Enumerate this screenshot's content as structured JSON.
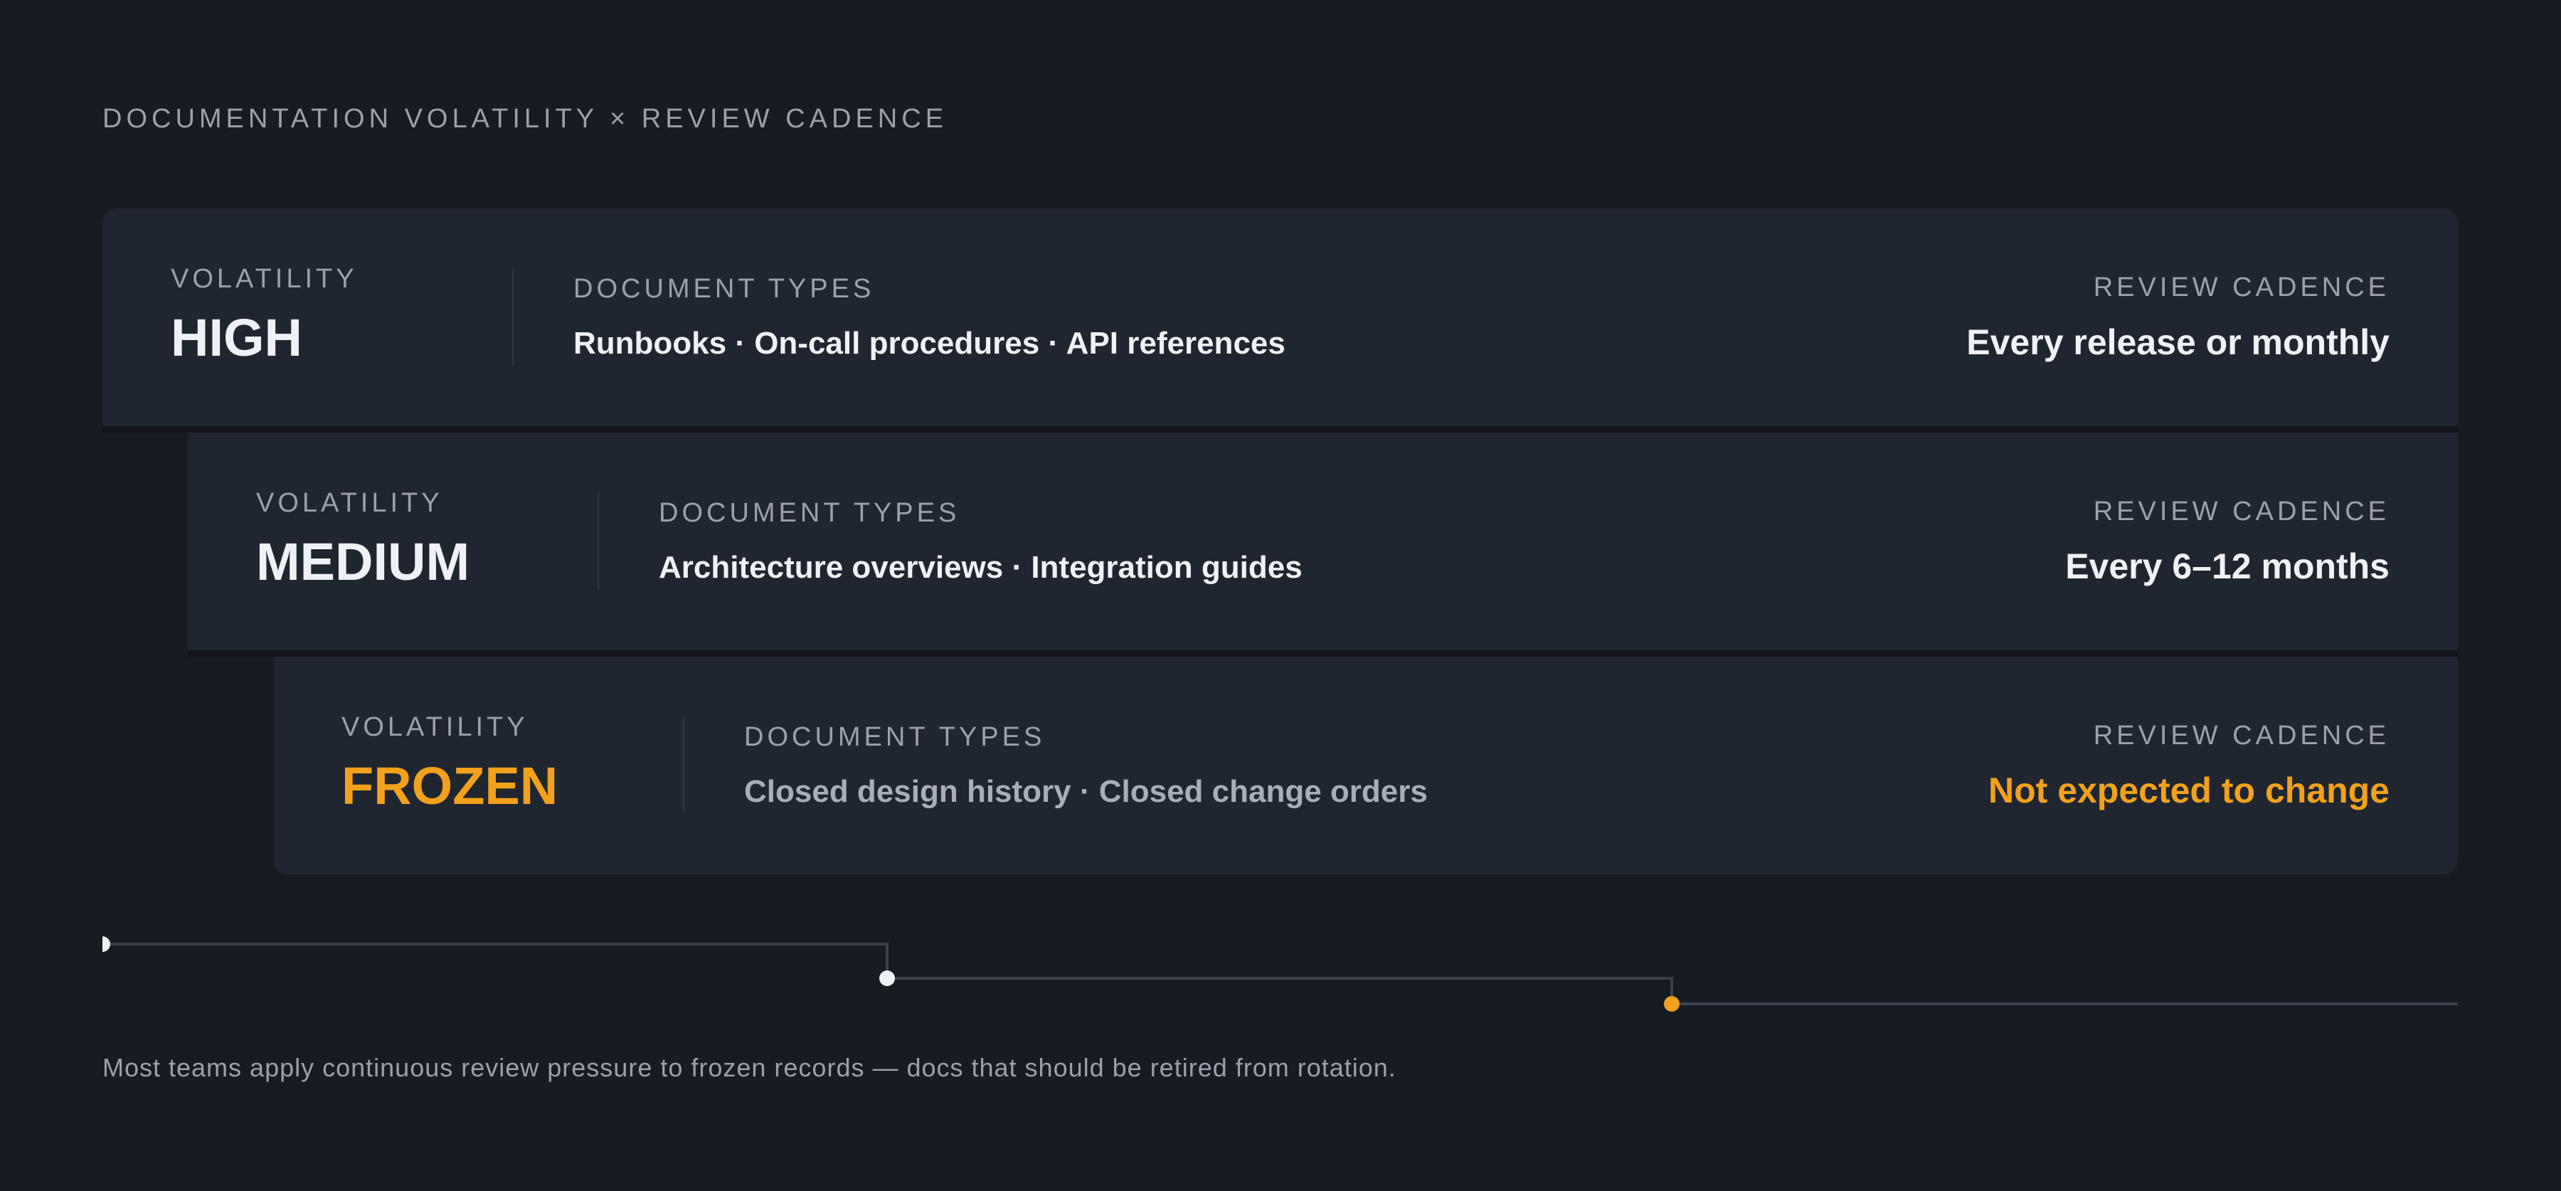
{
  "title": "DOCUMENTATION VOLATILITY × REVIEW CADENCE",
  "tiers": [
    {
      "volatility_label": "VOLATILITY",
      "level": "HIGH",
      "types_label": "DOCUMENT TYPES",
      "types": "Runbooks · On-call procedures · API references",
      "cadence_label": "REVIEW CADENCE",
      "cadence": "Every release or monthly"
    },
    {
      "volatility_label": "VOLATILITY",
      "level": "MEDIUM",
      "types_label": "DOCUMENT TYPES",
      "types": "Architecture overviews · Integration guides",
      "cadence_label": "REVIEW CADENCE",
      "cadence": "Every 6–12 months"
    },
    {
      "volatility_label": "VOLATILITY",
      "level": "FROZEN",
      "types_label": "DOCUMENT TYPES",
      "types": "Closed design history · Closed change orders",
      "cadence_label": "REVIEW CADENCE",
      "cadence": "Not expected to change"
    }
  ],
  "colors": {
    "background": "#171b22",
    "panel": "#20262f",
    "accent": "#f2a11c",
    "text": "#eef1f5",
    "muted": "#9aa1ab"
  },
  "footnote": "Most teams apply continuous review pressure to frozen records — docs that should be retired from rotation."
}
